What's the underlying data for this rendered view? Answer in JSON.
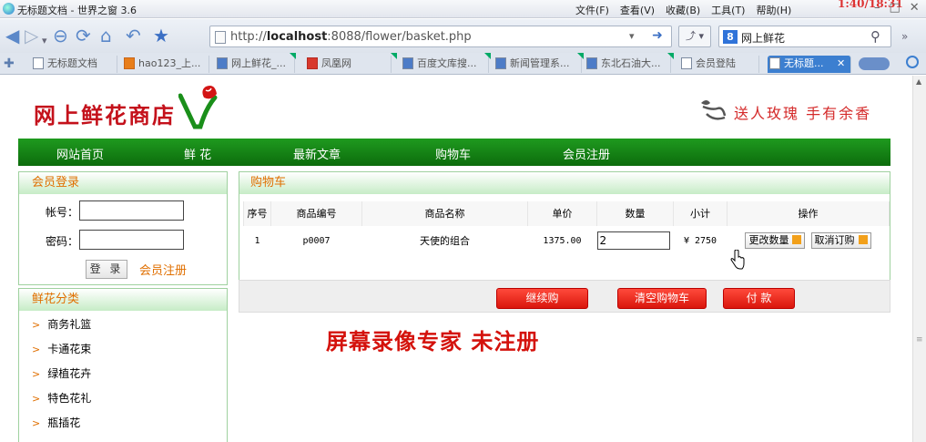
{
  "window": {
    "title": "无标题文档 - 世界之窗 3.6",
    "clock": "1:40/18:31"
  },
  "menu": [
    "文件(F)",
    "查看(V)",
    "收藏(B)",
    "工具(T)",
    "帮助(H)"
  ],
  "address": {
    "prefix": "http://",
    "host": "localhost",
    "rest": ":8088/flower/basket.php"
  },
  "search": {
    "engine_badge": "8",
    "query": "网上鲜花"
  },
  "tabs": [
    "无标题文档",
    "hao123_上...",
    "网上鲜花_...",
    "凤凰网",
    "百度文库搜...",
    "新闻管理系...",
    "东北石油大...",
    "会员登陆",
    "无标题..."
  ],
  "site": {
    "logo_text": "网上鲜花商店",
    "slogan": "送人玫瑰 手有余香"
  },
  "nav": [
    "网站首页",
    "鲜 花",
    "最新文章",
    "购物车",
    "会员注册"
  ],
  "login": {
    "title": "会员登录",
    "account_label": "帐号：",
    "password_label": "密码：",
    "login_button": "登 录",
    "register_link": "会员注册"
  },
  "categories": {
    "title": "鲜花分类",
    "items": [
      "商务礼篮",
      "卡通花束",
      "绿植花卉",
      "特色花礼",
      "瓶插花"
    ]
  },
  "cart": {
    "title": "购物车",
    "headers": [
      "序号",
      "商品编号",
      "商品名称",
      "单价",
      "数量",
      "小计",
      "操作"
    ],
    "rows": [
      {
        "no": "1",
        "code": "p0007",
        "name": "天使的组合",
        "price": "1375.00",
        "qty": "2",
        "subtotal": "¥ 2750"
      }
    ],
    "update_button": "更改数量",
    "cancel_button": "取消订购"
  },
  "actions": {
    "continue": "继续购",
    "clear": "清空购物车",
    "pay": "付 款"
  },
  "watermark": "屏幕录像专家 未注册",
  "colors": {
    "nav_green": "#0c6c0c",
    "accent_orange": "#e06f00",
    "brand_red": "#c4111b",
    "button_red": "#d9160c"
  }
}
